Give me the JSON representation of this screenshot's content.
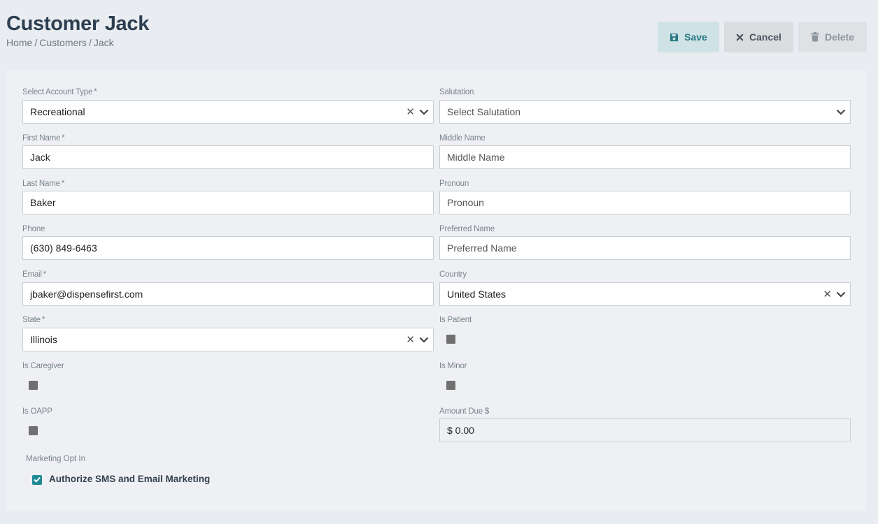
{
  "header": {
    "title": "Customer Jack",
    "breadcrumb": [
      "Home",
      "Customers",
      "Jack"
    ],
    "separator": "/"
  },
  "toolbar": {
    "save_label": "Save",
    "cancel_label": "Cancel",
    "delete_label": "Delete"
  },
  "form": {
    "account_type": {
      "label": "Select Account Type",
      "required": "*",
      "value": "Recreational"
    },
    "salutation": {
      "label": "Salutation",
      "placeholder": "Select Salutation"
    },
    "first_name": {
      "label": "First Name",
      "required": "*",
      "value": "Jack"
    },
    "middle_name": {
      "label": "Middle Name",
      "placeholder": "Middle Name"
    },
    "last_name": {
      "label": "Last Name",
      "required": "*",
      "value": "Baker"
    },
    "pronoun": {
      "label": "Pronoun",
      "placeholder": "Pronoun"
    },
    "phone": {
      "label": "Phone",
      "value": "(630) 849-6463"
    },
    "preferred_name": {
      "label": "Preferred Name",
      "placeholder": "Preferred Name"
    },
    "email": {
      "label": "Email",
      "required": "*",
      "value": "jbaker@dispensefirst.com"
    },
    "country": {
      "label": "Country",
      "value": "United States"
    },
    "state": {
      "label": "State",
      "required": "*",
      "value": "Illinois"
    },
    "is_patient": {
      "label": "Is Patient"
    },
    "is_caregiver": {
      "label": "Is Caregiver"
    },
    "is_minor": {
      "label": "Is Minor"
    },
    "is_oapp": {
      "label": "Is OAPP"
    },
    "amount_due": {
      "label": "Amount Due $",
      "value": "$ 0.00"
    },
    "marketing": {
      "label": "Marketing Opt In",
      "option": "Authorize SMS and Email Marketing"
    }
  },
  "colors": {
    "accent": "#1f8a96",
    "save_bg": "#cfe2e6",
    "panel_bg": "#eef0f3",
    "page_bg": "#e9ecf0"
  },
  "icons": {
    "save": "floppy-disk-icon",
    "cancel": "close-icon",
    "delete": "trash-icon",
    "clear": "clear-x-icon",
    "dropdown": "chevron-down-icon",
    "checked": "check-icon"
  }
}
